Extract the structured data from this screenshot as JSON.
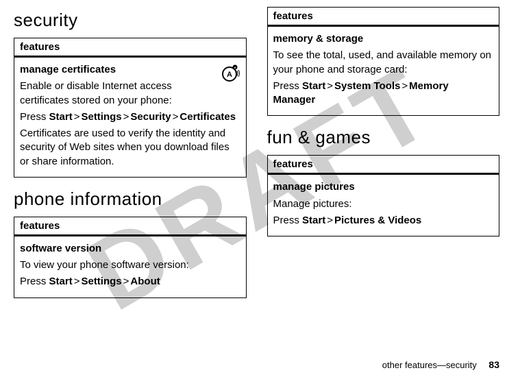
{
  "watermark": "DRAFT",
  "left": {
    "section1": "security",
    "box1": {
      "header": "features",
      "title": "manage certificates",
      "p1": "Enable or disable Internet access certificates stored on your phone:",
      "press": "Press",
      "path": [
        "Start",
        "Settings",
        "Security",
        "Certificates"
      ],
      "p2": "Certificates are used to verify the identity and security of Web sites when you download files or share information."
    },
    "section2": "phone information",
    "box2": {
      "header": "features",
      "title": "software version",
      "p1": "To view your phone software version:",
      "press": "Press",
      "path": [
        "Start",
        "Settings",
        "About"
      ]
    }
  },
  "right": {
    "box1": {
      "header": "features",
      "title": "memory & storage",
      "p1": "To see the total, used, and available memory on your phone and storage card:",
      "press": "Press",
      "path": [
        "Start",
        "System Tools",
        "Memory Manager"
      ]
    },
    "section1": "fun & games",
    "box2": {
      "header": "features",
      "title": "manage pictures",
      "p1": "Manage pictures:",
      "press": "Press",
      "path": [
        "Start",
        "Pictures & Videos"
      ]
    }
  },
  "footer": {
    "text": "other features—security",
    "page": "83"
  },
  "sep": ">"
}
